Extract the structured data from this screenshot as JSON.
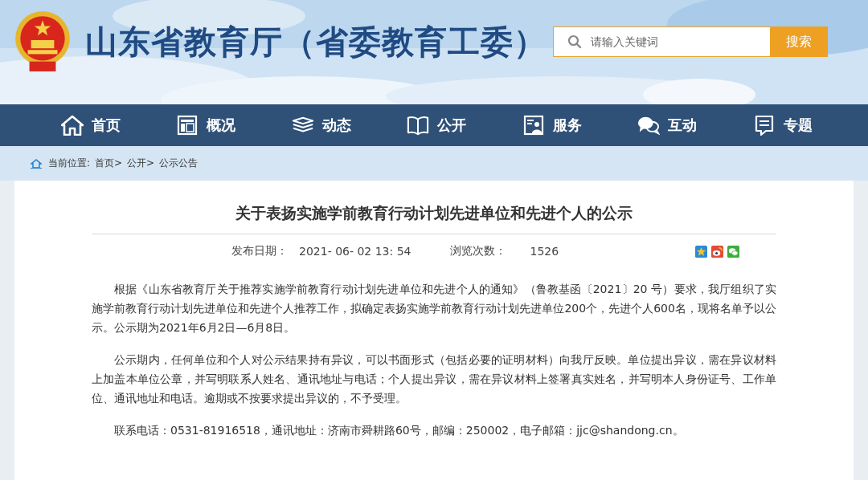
{
  "header": {
    "site_title": "山东省教育厅（省委教育工委）",
    "search": {
      "placeholder": "请输入关键词",
      "button": "搜索"
    }
  },
  "nav": [
    {
      "label": "首页"
    },
    {
      "label": "概况"
    },
    {
      "label": "动态"
    },
    {
      "label": "公开"
    },
    {
      "label": "服务"
    },
    {
      "label": "互动"
    },
    {
      "label": "专题"
    }
  ],
  "breadcrumb": {
    "prefix": "当前位置:",
    "items": [
      "首页>",
      "公开>",
      "公示公告"
    ]
  },
  "article": {
    "title": "关于表扬实施学前教育行动计划先进单位和先进个人的公示",
    "date_label": "发布日期：",
    "date": "2021- 06- 02 13: 54",
    "views_label": "浏览次数：",
    "views": "1526",
    "paragraphs": [
      "根据《山东省教育厅关于推荐实施学前教育行动计划先进单位和先进个人的通知》（鲁教基函〔2021〕20 号）要求，我厅组织了实施学前教育行动计划先进单位和先进个人推荐工作，拟确定表扬实施学前教育行动计划先进单位200个，先进个人600名，现将名单予以公示。公示期为2021年6月2日—6月8日。",
      "公示期内，任何单位和个人对公示结果持有异议，可以书面形式（包括必要的证明材料）向我厅反映。单位提出异议，需在异议材料上加盖本单位公章，并写明联系人姓名、通讯地址与电话；个人提出异议，需在异议材料上签署真实姓名，并写明本人身份证号、工作单位、通讯地址和电话。逾期或不按要求提出异议的，不予受理。",
      "联系电话：0531-81916518，通讯地址：济南市舜耕路60号，邮编：250002，电子邮箱：jjc@shandong.cn。"
    ]
  }
}
